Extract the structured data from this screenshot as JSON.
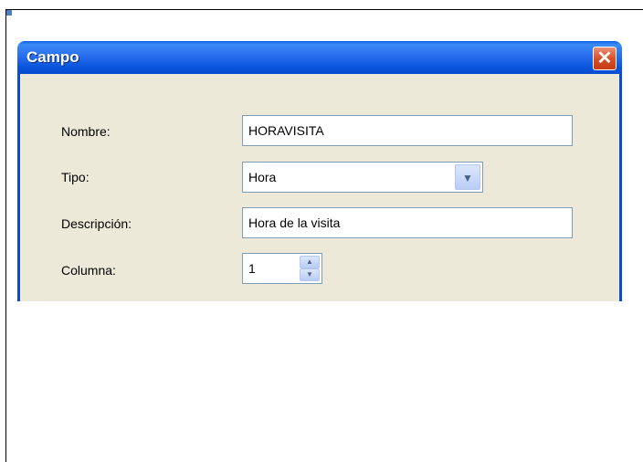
{
  "dialog": {
    "title": "Campo",
    "close_symbol": "✕"
  },
  "form": {
    "nombre": {
      "label": "Nombre:",
      "value": "HORAVISITA"
    },
    "tipo": {
      "label": "Tipo:",
      "value": "Hora"
    },
    "descripcion": {
      "label": "Descripción:",
      "value": "Hora de la visita"
    },
    "columna": {
      "label": "Columna:",
      "value": "1"
    }
  },
  "icons": {
    "dropdown": "chevron-down-icon",
    "spin_up": "spin-up-icon",
    "spin_down": "spin-down-icon"
  }
}
